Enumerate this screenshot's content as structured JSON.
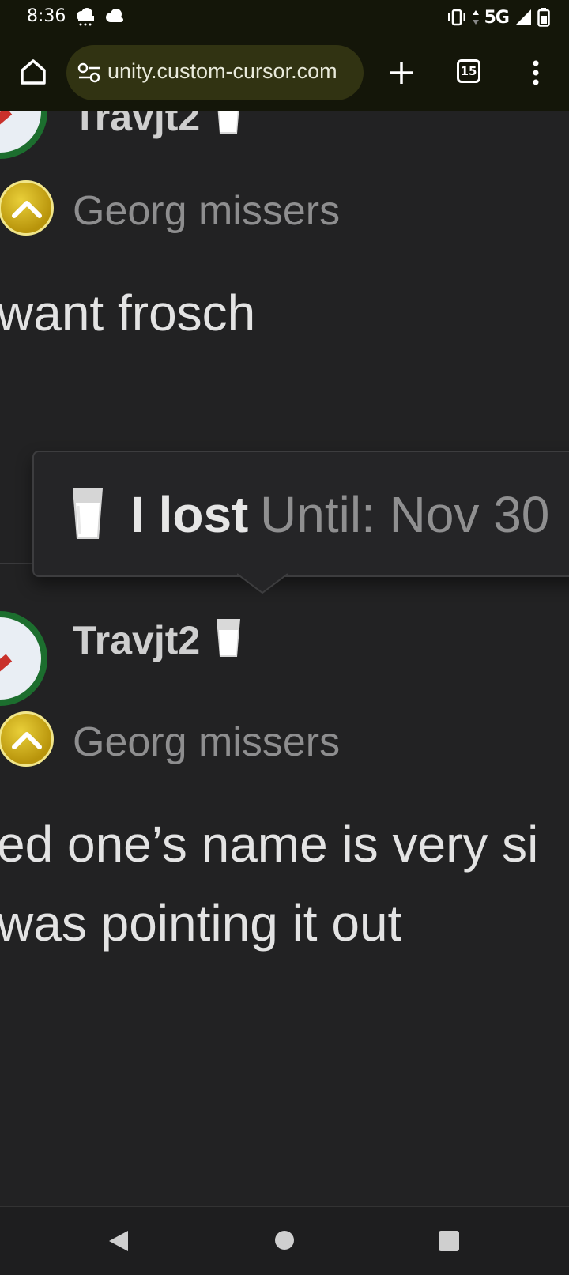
{
  "status_bar": {
    "time": "8:36",
    "network": "5G",
    "icons": [
      "weather-icon",
      "cloud-icon",
      "vibrate-icon",
      "signal-icon",
      "battery-icon"
    ]
  },
  "browser": {
    "url": "unity.custom-cursor.com",
    "tab_count": "15",
    "icons": [
      "home-icon",
      "site-settings-icon",
      "new-tab-icon",
      "tab-switcher-icon",
      "more-menu-icon"
    ]
  },
  "posts": [
    {
      "username": "Travjt2",
      "group": "Georg missers",
      "text": "want frosch"
    },
    {
      "username": "Travjt2",
      "group": "Georg missers",
      "lines": [
        "ed one’s name is very si",
        " was pointing it out"
      ]
    }
  ],
  "tooltip": {
    "status_title": "I lost",
    "status_until": "Until: Nov 30"
  },
  "colors": {
    "background": "#222223",
    "browser_bar": "#141609",
    "omnibox": "#313312",
    "badge_gold": "#d4b21f",
    "avatar_ring": "#1c6e2e"
  }
}
